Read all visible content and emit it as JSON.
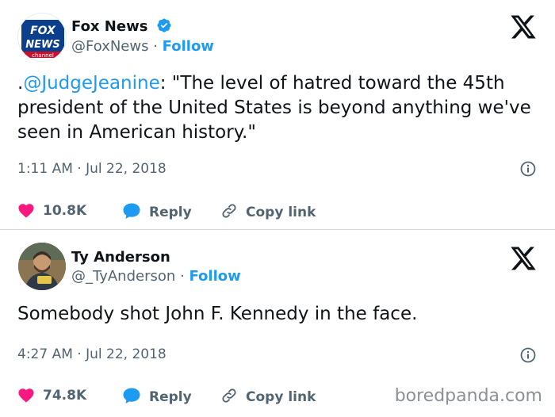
{
  "tweets": [
    {
      "author": "Fox News",
      "handle": "@FoxNews",
      "separator": "·",
      "follow": "Follow",
      "avatar_logo": {
        "line1": "FOX",
        "line2": "NEWS",
        "line3": "channel"
      },
      "text_prefix": ".",
      "mention": "@JudgeJeanine",
      "text_rest": ": \"The level of hatred toward the 45th president of the United States is beyond anything we've seen in American history.\"",
      "timestamp": "1:11 AM · Jul 22, 2018",
      "likes": "10.8K",
      "reply_label": "Reply",
      "copy_label": "Copy link"
    },
    {
      "author": "Ty Anderson",
      "handle": "@_TyAnderson",
      "separator": "·",
      "follow": "Follow",
      "text": "Somebody shot John F. Kennedy in the face.",
      "timestamp": "4:27 AM · Jul 22, 2018",
      "likes": "74.8K",
      "reply_label": "Reply",
      "copy_label": "Copy link"
    }
  ],
  "watermark": "boredpanda.com",
  "colors": {
    "accent": "#1d9bf0",
    "like": "#f91880",
    "muted": "#536471",
    "fox_blue": "#0b3f8c",
    "fox_red": "#c8102e"
  },
  "icons": [
    "x-logo-icon",
    "verified-badge-icon",
    "info-icon",
    "heart-icon",
    "reply-bubble-icon",
    "link-icon"
  ]
}
